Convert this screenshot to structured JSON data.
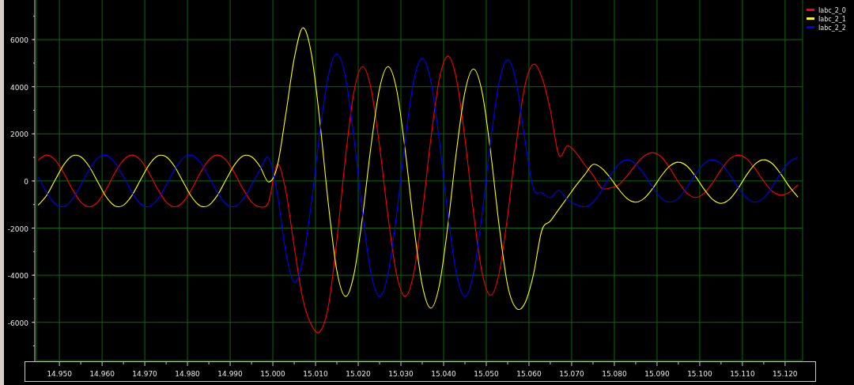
{
  "chart": {
    "chart_data": {
      "type": "line",
      "x": [
        14.945,
        14.947,
        14.949,
        14.951,
        14.953,
        14.955,
        14.957,
        14.959,
        14.961,
        14.963,
        14.965,
        14.967,
        14.969,
        14.971,
        14.973,
        14.975,
        14.977,
        14.979,
        14.981,
        14.983,
        14.985,
        14.987,
        14.989,
        14.991,
        14.993,
        14.995,
        14.997,
        14.999,
        15.001,
        15.003,
        15.005,
        15.007,
        15.009,
        15.011,
        15.013,
        15.015,
        15.017,
        15.019,
        15.021,
        15.023,
        15.025,
        15.027,
        15.029,
        15.031,
        15.033,
        15.035,
        15.037,
        15.039,
        15.041,
        15.043,
        15.045,
        15.047,
        15.049,
        15.051,
        15.053,
        15.055,
        15.057,
        15.059,
        15.061,
        15.063,
        15.065,
        15.067,
        15.069,
        15.071,
        15.073,
        15.075,
        15.077,
        15.079,
        15.081,
        15.083,
        15.085,
        15.087,
        15.089,
        15.091,
        15.093,
        15.095,
        15.097,
        15.099,
        15.101,
        15.103,
        15.105,
        15.107,
        15.109,
        15.111,
        15.113,
        15.115,
        15.117,
        15.119,
        15.121,
        15.123
      ],
      "series": [
        {
          "name": "Iabc_2_0",
          "color": "#ff0000",
          "values": [
            890,
            1100,
            890,
            340,
            -340,
            -890,
            -1100,
            -890,
            -340,
            340,
            890,
            1100,
            890,
            340,
            -340,
            -890,
            -1100,
            -890,
            -340,
            340,
            890,
            1100,
            890,
            340,
            -340,
            -890,
            -1100,
            -890,
            700,
            -400,
            -2800,
            -5000,
            -6100,
            -6400,
            -5326,
            -2513,
            963,
            3776,
            4850,
            3919,
            1481,
            -1531,
            -3969,
            -4900,
            -3926,
            -1376,
            1776,
            4326,
            5300,
            4331,
            1793,
            -1343,
            -3881,
            -4850,
            -3914,
            -1464,
            1564,
            4014,
            4950,
            4400,
            3000,
            1100,
            1500,
            1200,
            700,
            250,
            -300,
            -300,
            -160,
            220,
            680,
            1060,
            1200,
            1020,
            545,
            -45,
            -520,
            -700,
            -530,
            -80,
            480,
            930,
            1100,
            940,
            510,
            -10,
            -440,
            -600,
            -480,
            -160
          ]
        },
        {
          "name": "Iabc_2_1",
          "color": "#ffff00",
          "values": [
            -1030,
            -610,
            45,
            680,
            1060,
            1030,
            610,
            -45,
            -680,
            -1060,
            -1030,
            -610,
            45,
            680,
            1060,
            1030,
            610,
            -45,
            -680,
            -1060,
            -1030,
            -610,
            45,
            680,
            1060,
            1030,
            610,
            -45,
            600,
            2800,
            5200,
            6500,
            5411,
            2561,
            -961,
            -3811,
            -4900,
            -3969,
            -1531,
            1481,
            3919,
            4850,
            3871,
            1309,
            -1859,
            -4421,
            -5400,
            -4431,
            -1893,
            1243,
            3781,
            4750,
            3781,
            1243,
            -1893,
            -4431,
            -5400,
            -5200,
            -4000,
            -2100,
            -1700,
            -1200,
            -700,
            -200,
            250,
            700,
            547,
            147,
            -347,
            -747,
            -900,
            -738,
            -313,
            213,
            638,
            800,
            633,
            195,
            -345,
            -783,
            -950,
            -773,
            -311,
            261,
            723,
            900,
            733,
            295,
            -245,
            -683
          ]
        },
        {
          "name": "Iabc_2_2",
          "color": "#0000ff",
          "values": [
            180,
            -490,
            -975,
            -1090,
            -785,
            -180,
            490,
            975,
            1090,
            785,
            180,
            -490,
            -975,
            -1090,
            -785,
            -180,
            490,
            975,
            1090,
            785,
            180,
            -490,
            -975,
            -1090,
            -785,
            -180,
            490,
            975,
            -500,
            -3000,
            -4300,
            -3374,
            -949,
            2049,
            4474,
            5400,
            4416,
            1841,
            -1341,
            -3916,
            -4900,
            -3935,
            -1410,
            1710,
            4235,
            5200,
            4235,
            1710,
            -1410,
            -3935,
            -4900,
            -3940,
            -1428,
            1678,
            4190,
            5150,
            4200,
            1800,
            -300,
            -500,
            -700,
            -400,
            -800,
            -1000,
            -1100,
            -909,
            -409,
            209,
            709,
            900,
            728,
            278,
            -278,
            -728,
            -900,
            -728,
            -278,
            278,
            728,
            900,
            728,
            278,
            -278,
            -728,
            -900,
            -719,
            -244,
            344,
            819,
            1000
          ]
        }
      ],
      "xlim": [
        14.9446,
        15.1241
      ],
      "ylim": [
        -7620,
        7680
      ],
      "xticks": [
        {
          "value": 14.95,
          "label": "14.950"
        },
        {
          "value": 14.96,
          "label": "14.960"
        },
        {
          "value": 14.97,
          "label": "14.970"
        },
        {
          "value": 14.98,
          "label": "14.980"
        },
        {
          "value": 14.99,
          "label": "14.990"
        },
        {
          "value": 15.0,
          "label": "15.000"
        },
        {
          "value": 15.01,
          "label": "15.010"
        },
        {
          "value": 15.02,
          "label": "15.020"
        },
        {
          "value": 15.03,
          "label": "15.030"
        },
        {
          "value": 15.04,
          "label": "15.040"
        },
        {
          "value": 15.05,
          "label": "15.050"
        },
        {
          "value": 15.06,
          "label": "15.060"
        },
        {
          "value": 15.07,
          "label": "15.070"
        },
        {
          "value": 15.08,
          "label": "15.080"
        },
        {
          "value": 15.09,
          "label": "15.090"
        },
        {
          "value": 15.1,
          "label": "15.100"
        },
        {
          "value": 15.11,
          "label": "15.110"
        },
        {
          "value": 15.12,
          "label": "15.120"
        }
      ],
      "yticks": [
        -6000,
        -4000,
        -2000,
        0,
        2000,
        4000,
        6000
      ],
      "grid": true,
      "legend": true
    }
  }
}
